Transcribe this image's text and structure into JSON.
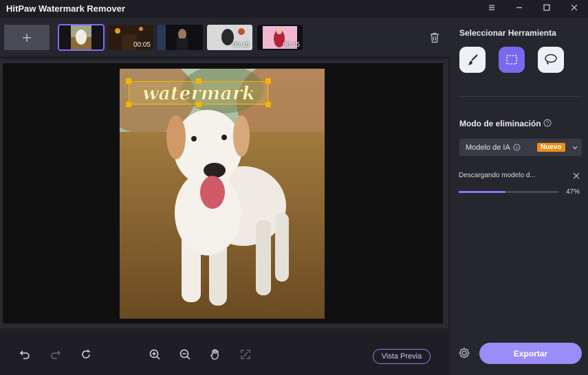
{
  "app": {
    "title": "HitPaw Watermark Remover"
  },
  "window_controls": [
    "menu-icon",
    "minimize-icon",
    "maximize-icon",
    "close-icon"
  ],
  "thumbnails": [
    {
      "name": "dog",
      "duration": "",
      "selected": true
    },
    {
      "name": "video-2",
      "duration": "00:05",
      "selected": false
    },
    {
      "name": "video-3",
      "duration": "",
      "selected": false
    },
    {
      "name": "video-4",
      "duration": "00:15",
      "selected": false
    },
    {
      "name": "video-5",
      "duration": "00:15",
      "selected": false
    }
  ],
  "canvas": {
    "watermark_text": "watermark"
  },
  "bottom_toolbar": {
    "tools": [
      "undo-icon",
      "redo-icon",
      "reset-icon",
      "zoom-in-icon",
      "zoom-out-icon",
      "hand-icon",
      "fit-icon"
    ],
    "preview_label": "Vista Previa"
  },
  "panel": {
    "tool_title": "Seleccionar Herramienta",
    "tools": [
      {
        "icon": "brush-icon",
        "active": false
      },
      {
        "icon": "rectangle-select-icon",
        "active": true
      },
      {
        "icon": "lasso-icon",
        "active": false
      }
    ],
    "mode_title": "Modo de eliminación",
    "mode_select": {
      "value": "Modelo de IA",
      "badge": "Nuevo"
    },
    "download": {
      "text": "Descargando modelo d...",
      "percent_label": "47%",
      "percent": 47
    },
    "export_label": "Exportar"
  },
  "colors": {
    "accent": "#7b68ee",
    "badge": "#f08a14",
    "selection": "#f5b400"
  }
}
